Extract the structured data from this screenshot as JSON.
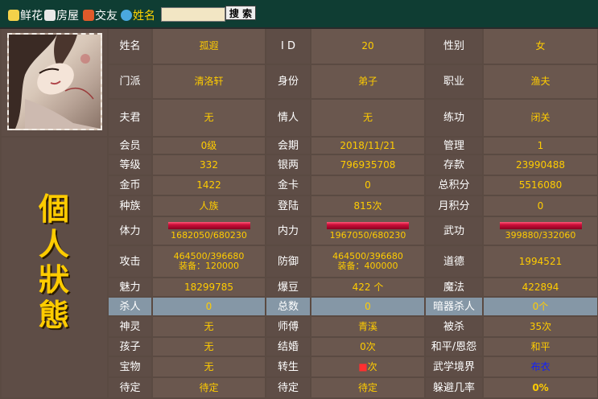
{
  "nav": {
    "items": [
      {
        "label": "鲜花",
        "icon": "flower-icon",
        "color": "#ffffff"
      },
      {
        "label": "房屋",
        "icon": "house-icon",
        "color": "#ffffff"
      },
      {
        "label": "交友",
        "icon": "gift-icon",
        "color": "#ffffff"
      },
      {
        "label": "姓名",
        "icon": "globe-icon",
        "color": "#ffd400"
      }
    ],
    "search_button": "搜 索",
    "search_value": ""
  },
  "status_title": [
    "個",
    "人",
    "狀",
    "態"
  ],
  "profile": {
    "rows": [
      [
        {
          "label": "姓名",
          "value": "孤遐"
        },
        {
          "label": "I D",
          "value": "20"
        },
        {
          "label": "性别",
          "value": "女"
        }
      ],
      [
        {
          "label": "门派",
          "value": "清洛轩"
        },
        {
          "label": "身份",
          "value": "弟子"
        },
        {
          "label": "职业",
          "value": "渔夫"
        }
      ],
      [
        {
          "label": "夫君",
          "value": "无"
        },
        {
          "label": "情人",
          "value": "无"
        },
        {
          "label": "练功",
          "value": "闭关"
        }
      ]
    ]
  },
  "stats": {
    "rows": [
      [
        {
          "label": "会员",
          "value": "0级"
        },
        {
          "label": "会期",
          "value": "2018/11/21"
        },
        {
          "label": "管理",
          "value": "1"
        }
      ],
      [
        {
          "label": "等级",
          "value": "332"
        },
        {
          "label": "银两",
          "value": "796935708"
        },
        {
          "label": "存款",
          "value": "23990488"
        }
      ],
      [
        {
          "label": "金币",
          "value": "1422"
        },
        {
          "label": "金卡",
          "value": "0"
        },
        {
          "label": "总积分",
          "value": "5516080"
        }
      ],
      [
        {
          "label": "种族",
          "value": "人族"
        },
        {
          "label": "登陆",
          "value": "815次"
        },
        {
          "label": "月积分",
          "value": "0"
        }
      ],
      [
        {
          "label": "体力",
          "value": "1682050/680230",
          "bar": 1.0
        },
        {
          "label": "内力",
          "value": "1967050/680230",
          "bar": 1.0
        },
        {
          "label": "武功",
          "value": "399880/332060",
          "bar": 1.0
        }
      ],
      [
        {
          "label": "攻击",
          "value": "464500/396680",
          "value2": "装备：120000"
        },
        {
          "label": "防御",
          "value": "464500/396680",
          "value2": "装备：400000"
        },
        {
          "label": "道德",
          "value": "1994521"
        }
      ],
      [
        {
          "label": "魅力",
          "value": "18299785"
        },
        {
          "label": "爆豆",
          "value": "422 个"
        },
        {
          "label": "魔法",
          "value": "422894"
        }
      ],
      [
        {
          "label": "杀人",
          "value": "0"
        },
        {
          "label": "总数",
          "value": "0"
        },
        {
          "label": "暗器杀人",
          "value": "0个"
        }
      ],
      [
        {
          "label": "神灵",
          "value": "无"
        },
        {
          "label": "师傅",
          "value": "青溪"
        },
        {
          "label": "被杀",
          "value": "35次"
        }
      ],
      [
        {
          "label": "孩子",
          "value": "无"
        },
        {
          "label": "结婚",
          "value": "0次"
        },
        {
          "label": "和平/恩怨",
          "value": "和平"
        }
      ],
      [
        {
          "label": "宝物",
          "value": "无"
        },
        {
          "label": "转生",
          "value": "次"
        },
        {
          "label": "武学境界",
          "value": "布衣"
        }
      ],
      [
        {
          "label": "待定",
          "value": "待定"
        },
        {
          "label": "待定",
          "value": "待定"
        },
        {
          "label": "躲避几率",
          "value": "0%"
        }
      ]
    ]
  },
  "colors": {
    "label_bg": "#5e4d46",
    "value_bg": "#6a574e",
    "value_text": "#ffcc00",
    "highlight_bg": "#8597a6",
    "accent_red": "#ff3030",
    "accent_blue": "#1020ff"
  }
}
